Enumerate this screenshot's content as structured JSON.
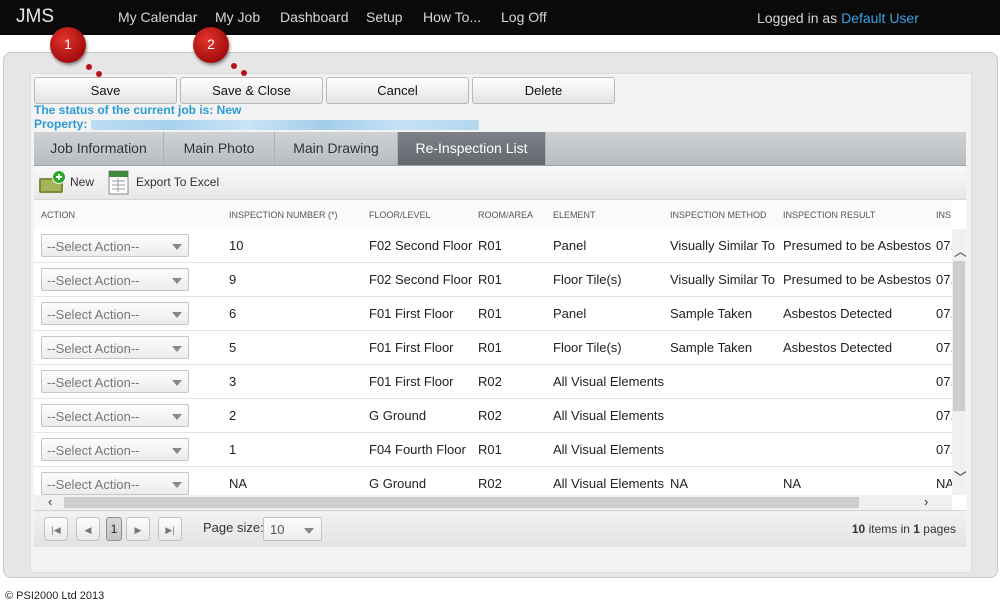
{
  "app": {
    "brand": "JMS"
  },
  "nav": {
    "items": [
      "My Calendar",
      "My Job",
      "Dashboard",
      "Setup",
      "How To...",
      "Log Off"
    ]
  },
  "user": {
    "prefix": "Logged in as",
    "name": "Default User"
  },
  "actions": {
    "save": "Save",
    "save_close": "Save & Close",
    "cancel": "Cancel",
    "delete": "Delete"
  },
  "markers": [
    "1",
    "2"
  ],
  "job": {
    "status_text": "The status of the current job is: New",
    "property_label": "Property:"
  },
  "tabs": [
    "Job Information",
    "Main Photo",
    "Main Drawing",
    "Re-Inspection List"
  ],
  "active_tab": "Re-Inspection List",
  "toolbar": {
    "new_label": "New",
    "export_label": "Export To Excel"
  },
  "grid": {
    "columns": [
      "ACTION",
      "INSPECTION NUMBER (*)",
      "FLOOR/LEVEL",
      "ROOM/AREA",
      "ELEMENT",
      "INSPECTION METHOD",
      "INSPECTION RESULT",
      "INS"
    ],
    "select_placeholder": "--Select Action--",
    "rows": [
      {
        "num": "10",
        "floor": "F02 Second Floor",
        "room": "R01",
        "element": "Panel",
        "method": "Visually Similar To",
        "result": "Presumed to be Asbestos",
        "extra": "07."
      },
      {
        "num": "9",
        "floor": "F02 Second Floor",
        "room": "R01",
        "element": "Floor Tile(s)",
        "method": "Visually Similar To",
        "result": "Presumed to be Asbestos",
        "extra": "07."
      },
      {
        "num": "6",
        "floor": "F01 First Floor",
        "room": "R01",
        "element": "Panel",
        "method": "Sample Taken",
        "result": "Asbestos Detected",
        "extra": "07."
      },
      {
        "num": "5",
        "floor": "F01 First Floor",
        "room": "R01",
        "element": "Floor Tile(s)",
        "method": "Sample Taken",
        "result": "Asbestos Detected",
        "extra": "07."
      },
      {
        "num": "3",
        "floor": "F01 First Floor",
        "room": "R02",
        "element": "All Visual Elements",
        "method": "",
        "result": "",
        "extra": "07."
      },
      {
        "num": "2",
        "floor": "G Ground",
        "room": "R02",
        "element": "All Visual Elements",
        "method": "",
        "result": "",
        "extra": "07."
      },
      {
        "num": "1",
        "floor": "F04 Fourth Floor",
        "room": "R01",
        "element": "All Visual Elements",
        "method": "",
        "result": "",
        "extra": "07."
      },
      {
        "num": "NA",
        "floor": "G Ground",
        "room": "R02",
        "element": "All Visual Elements",
        "method": "NA",
        "result": "NA",
        "extra": "NA"
      }
    ]
  },
  "pager": {
    "current_page": "1",
    "page_size_label": "Page size:",
    "page_size": "10",
    "items_count": "10",
    "items_text": "items in",
    "pages_count": "1",
    "pages_text": "pages"
  },
  "footer": {
    "copyright": "© PSI2000 Ltd 2013"
  }
}
